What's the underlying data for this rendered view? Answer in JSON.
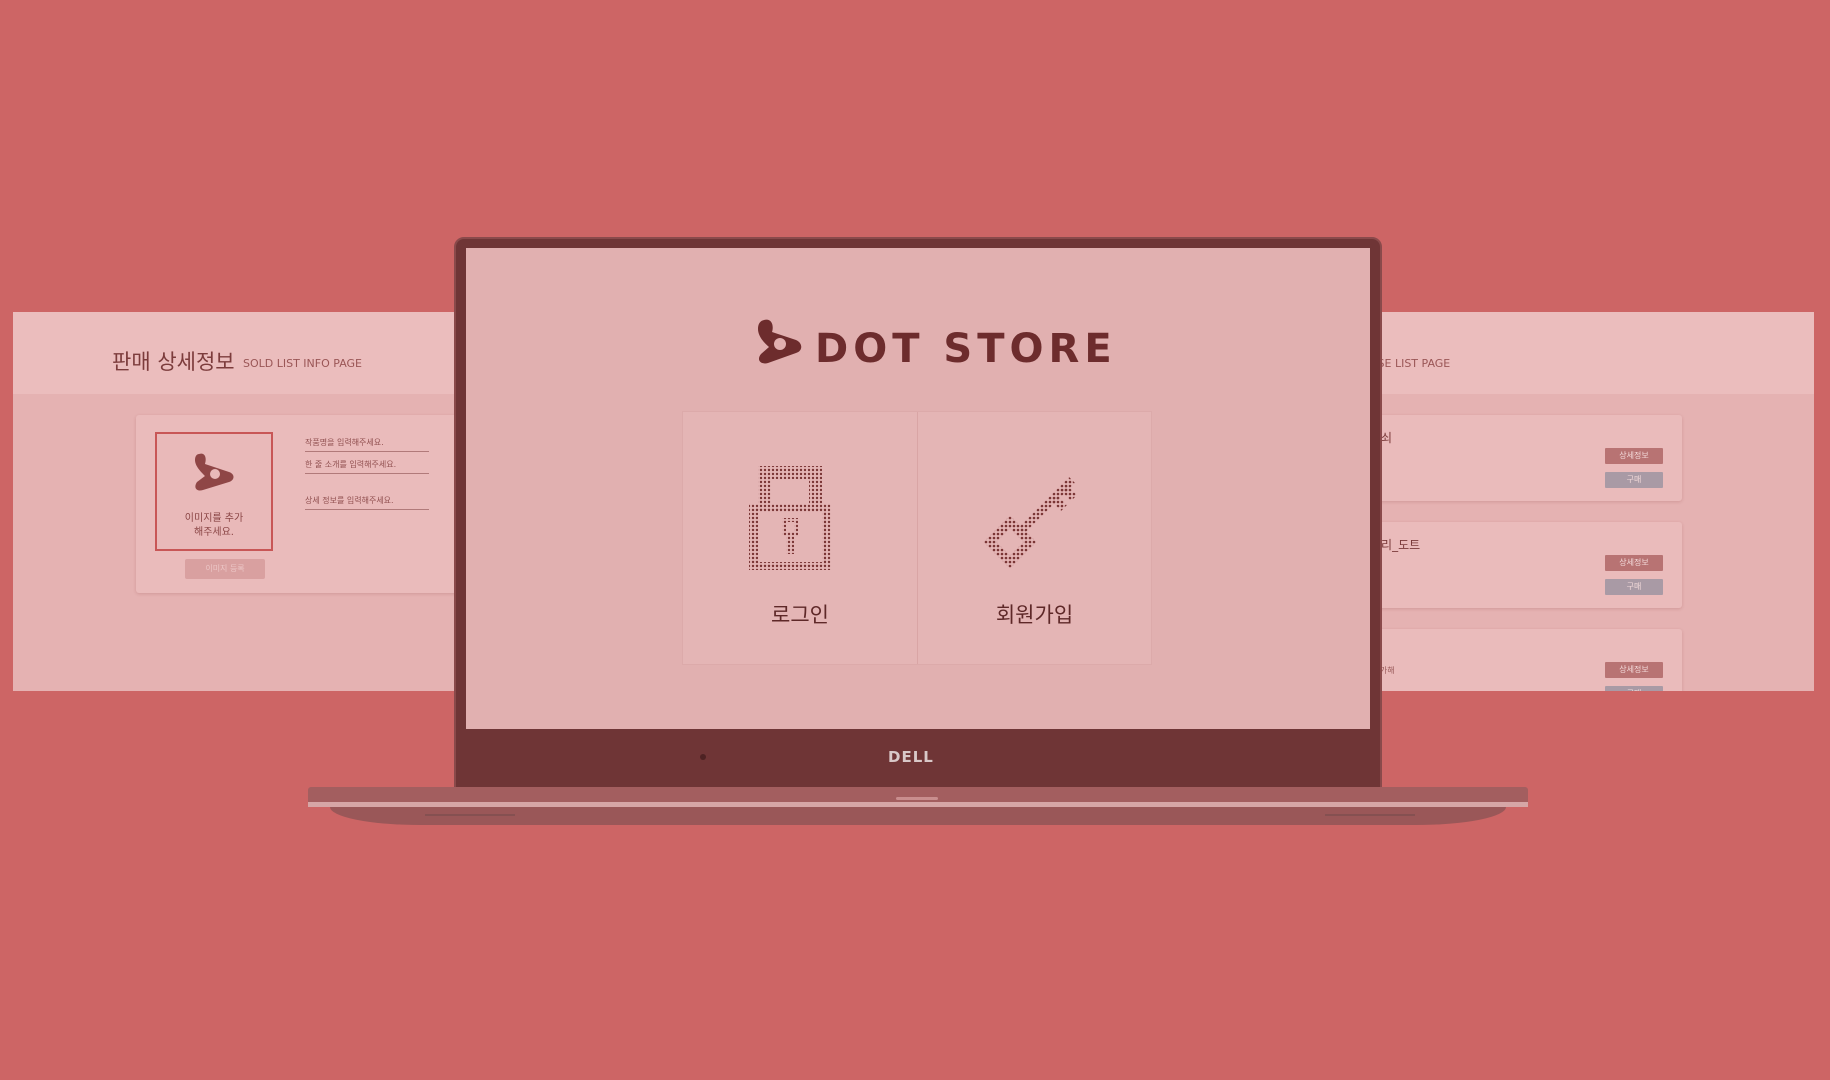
{
  "left_panel": {
    "title": "판매 상세정보",
    "subtitle": "SOLD LIST INFO PAGE",
    "image_placeholder": "이미지를 추가\n해주세요.",
    "image_register_button": "이미지 등록",
    "fields": [
      "작품명을 입력해주세요.",
      "한 줄 소개를 입력해주세요.",
      "상세 정보를 입력해주세요."
    ]
  },
  "right_panel": {
    "subtitle": "ASE LIST PAGE",
    "items": [
      {
        "name": "열쇠",
        "desc": "",
        "detail_label": "상세정보",
        "buy_label": "구매"
      },
      {
        "name": "고리_도트",
        "desc": "",
        "detail_label": "상세정보",
        "buy_label": "구매"
      },
      {
        "name": "",
        "desc": "은 가해",
        "detail_label": "상세정보",
        "buy_label": "구매"
      }
    ]
  },
  "screen": {
    "brand": "DOT STORE",
    "menu": [
      {
        "label": "로그인",
        "icon": "lock-icon"
      },
      {
        "label": "회원가입",
        "icon": "key-icon"
      }
    ]
  },
  "laptop": {
    "brand": "DELL"
  },
  "colors": {
    "background": "#cd6565",
    "screen": "#e1b0b0",
    "brand_text": "#6d2c2d",
    "bezel": "#6f3536"
  }
}
